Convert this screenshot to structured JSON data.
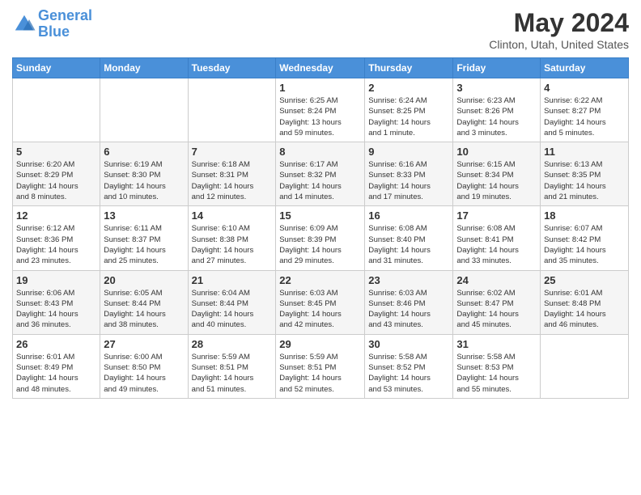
{
  "header": {
    "logo_line1": "General",
    "logo_line2": "Blue",
    "month": "May 2024",
    "location": "Clinton, Utah, United States"
  },
  "weekdays": [
    "Sunday",
    "Monday",
    "Tuesday",
    "Wednesday",
    "Thursday",
    "Friday",
    "Saturday"
  ],
  "weeks": [
    [
      {
        "day": "",
        "info": ""
      },
      {
        "day": "",
        "info": ""
      },
      {
        "day": "",
        "info": ""
      },
      {
        "day": "1",
        "info": "Sunrise: 6:25 AM\nSunset: 8:24 PM\nDaylight: 13 hours\nand 59 minutes."
      },
      {
        "day": "2",
        "info": "Sunrise: 6:24 AM\nSunset: 8:25 PM\nDaylight: 14 hours\nand 1 minute."
      },
      {
        "day": "3",
        "info": "Sunrise: 6:23 AM\nSunset: 8:26 PM\nDaylight: 14 hours\nand 3 minutes."
      },
      {
        "day": "4",
        "info": "Sunrise: 6:22 AM\nSunset: 8:27 PM\nDaylight: 14 hours\nand 5 minutes."
      }
    ],
    [
      {
        "day": "5",
        "info": "Sunrise: 6:20 AM\nSunset: 8:29 PM\nDaylight: 14 hours\nand 8 minutes."
      },
      {
        "day": "6",
        "info": "Sunrise: 6:19 AM\nSunset: 8:30 PM\nDaylight: 14 hours\nand 10 minutes."
      },
      {
        "day": "7",
        "info": "Sunrise: 6:18 AM\nSunset: 8:31 PM\nDaylight: 14 hours\nand 12 minutes."
      },
      {
        "day": "8",
        "info": "Sunrise: 6:17 AM\nSunset: 8:32 PM\nDaylight: 14 hours\nand 14 minutes."
      },
      {
        "day": "9",
        "info": "Sunrise: 6:16 AM\nSunset: 8:33 PM\nDaylight: 14 hours\nand 17 minutes."
      },
      {
        "day": "10",
        "info": "Sunrise: 6:15 AM\nSunset: 8:34 PM\nDaylight: 14 hours\nand 19 minutes."
      },
      {
        "day": "11",
        "info": "Sunrise: 6:13 AM\nSunset: 8:35 PM\nDaylight: 14 hours\nand 21 minutes."
      }
    ],
    [
      {
        "day": "12",
        "info": "Sunrise: 6:12 AM\nSunset: 8:36 PM\nDaylight: 14 hours\nand 23 minutes."
      },
      {
        "day": "13",
        "info": "Sunrise: 6:11 AM\nSunset: 8:37 PM\nDaylight: 14 hours\nand 25 minutes."
      },
      {
        "day": "14",
        "info": "Sunrise: 6:10 AM\nSunset: 8:38 PM\nDaylight: 14 hours\nand 27 minutes."
      },
      {
        "day": "15",
        "info": "Sunrise: 6:09 AM\nSunset: 8:39 PM\nDaylight: 14 hours\nand 29 minutes."
      },
      {
        "day": "16",
        "info": "Sunrise: 6:08 AM\nSunset: 8:40 PM\nDaylight: 14 hours\nand 31 minutes."
      },
      {
        "day": "17",
        "info": "Sunrise: 6:08 AM\nSunset: 8:41 PM\nDaylight: 14 hours\nand 33 minutes."
      },
      {
        "day": "18",
        "info": "Sunrise: 6:07 AM\nSunset: 8:42 PM\nDaylight: 14 hours\nand 35 minutes."
      }
    ],
    [
      {
        "day": "19",
        "info": "Sunrise: 6:06 AM\nSunset: 8:43 PM\nDaylight: 14 hours\nand 36 minutes."
      },
      {
        "day": "20",
        "info": "Sunrise: 6:05 AM\nSunset: 8:44 PM\nDaylight: 14 hours\nand 38 minutes."
      },
      {
        "day": "21",
        "info": "Sunrise: 6:04 AM\nSunset: 8:44 PM\nDaylight: 14 hours\nand 40 minutes."
      },
      {
        "day": "22",
        "info": "Sunrise: 6:03 AM\nSunset: 8:45 PM\nDaylight: 14 hours\nand 42 minutes."
      },
      {
        "day": "23",
        "info": "Sunrise: 6:03 AM\nSunset: 8:46 PM\nDaylight: 14 hours\nand 43 minutes."
      },
      {
        "day": "24",
        "info": "Sunrise: 6:02 AM\nSunset: 8:47 PM\nDaylight: 14 hours\nand 45 minutes."
      },
      {
        "day": "25",
        "info": "Sunrise: 6:01 AM\nSunset: 8:48 PM\nDaylight: 14 hours\nand 46 minutes."
      }
    ],
    [
      {
        "day": "26",
        "info": "Sunrise: 6:01 AM\nSunset: 8:49 PM\nDaylight: 14 hours\nand 48 minutes."
      },
      {
        "day": "27",
        "info": "Sunrise: 6:00 AM\nSunset: 8:50 PM\nDaylight: 14 hours\nand 49 minutes."
      },
      {
        "day": "28",
        "info": "Sunrise: 5:59 AM\nSunset: 8:51 PM\nDaylight: 14 hours\nand 51 minutes."
      },
      {
        "day": "29",
        "info": "Sunrise: 5:59 AM\nSunset: 8:51 PM\nDaylight: 14 hours\nand 52 minutes."
      },
      {
        "day": "30",
        "info": "Sunrise: 5:58 AM\nSunset: 8:52 PM\nDaylight: 14 hours\nand 53 minutes."
      },
      {
        "day": "31",
        "info": "Sunrise: 5:58 AM\nSunset: 8:53 PM\nDaylight: 14 hours\nand 55 minutes."
      },
      {
        "day": "",
        "info": ""
      }
    ]
  ]
}
